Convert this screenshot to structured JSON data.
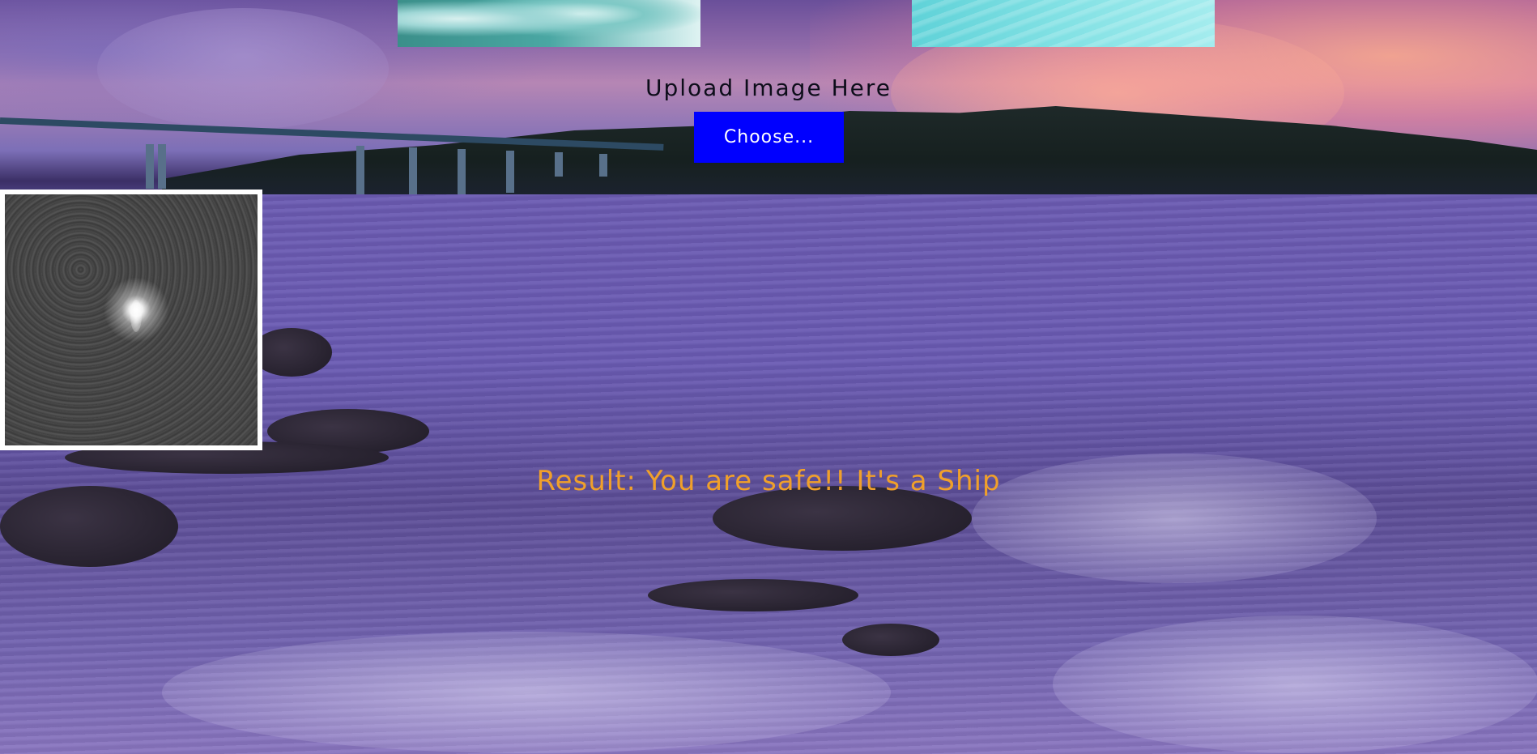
{
  "upload": {
    "title": "Upload Image Here",
    "choose_label": "Choose..."
  },
  "result": {
    "text": "Result: You are safe!! It's a Ship"
  },
  "colors": {
    "button": "#0000ff",
    "result_text": "#f0a02a",
    "title_text": "#0d0d1a"
  }
}
